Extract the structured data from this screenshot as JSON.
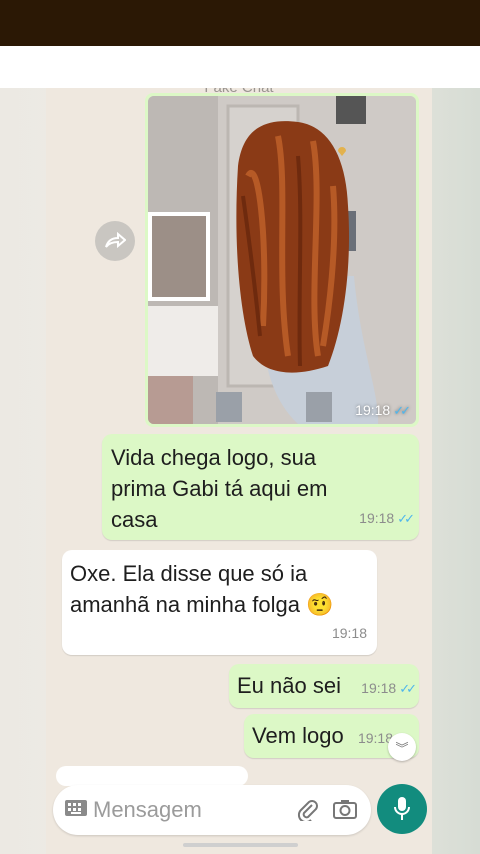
{
  "header": {
    "title": "Fake Chat"
  },
  "image_message": {
    "time": "19:18",
    "status": "read"
  },
  "messages": [
    {
      "direction": "out",
      "text": "Vida chega logo, sua prima Gabi tá aqui em casa",
      "time": "19:18",
      "status": "read"
    },
    {
      "direction": "in",
      "text": "Oxe. Ela disse que só ia amanhã na minha folga 🤨",
      "time": "19:18"
    },
    {
      "direction": "out",
      "text": "Eu não sei",
      "time": "19:18",
      "status": "read"
    },
    {
      "direction": "out",
      "text": "Vem logo",
      "time": "19:18",
      "status": "read"
    }
  ],
  "input": {
    "placeholder": "Mensagem"
  },
  "icons": {
    "forward": "forward-icon",
    "scroll_down": "double-chevron-down-icon",
    "keyboard": "keyboard-icon",
    "attach": "paperclip-icon",
    "camera": "camera-icon",
    "mic": "mic-icon"
  },
  "colors": {
    "outgoing": "#dcf8c6",
    "incoming": "#ffffff",
    "accent": "#128c7e",
    "ticks": "#4fb6ec"
  }
}
